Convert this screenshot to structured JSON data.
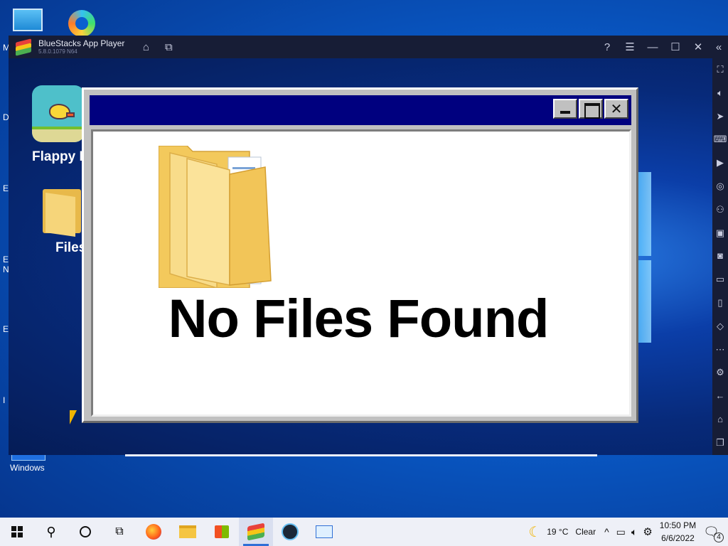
{
  "bluestacks": {
    "title": "BlueStacks App Player",
    "version": "5.8.0.1079 N64"
  },
  "android_apps": [
    {
      "label": "Flappy B"
    },
    {
      "label": "Files"
    }
  ],
  "dialog": {
    "message": "No Files Found",
    "close_glyph": "✕"
  },
  "desktop": {
    "windows_shortcut_label": "Windows",
    "left_edge_letters": [
      "M",
      "D",
      "E",
      "E",
      "N",
      "E",
      "I"
    ]
  },
  "taskbar": {
    "weather_temp": "19 °C",
    "weather_desc": "Clear",
    "time": "10:50 PM",
    "date": "6/6/2022",
    "notifications_count": "4"
  }
}
